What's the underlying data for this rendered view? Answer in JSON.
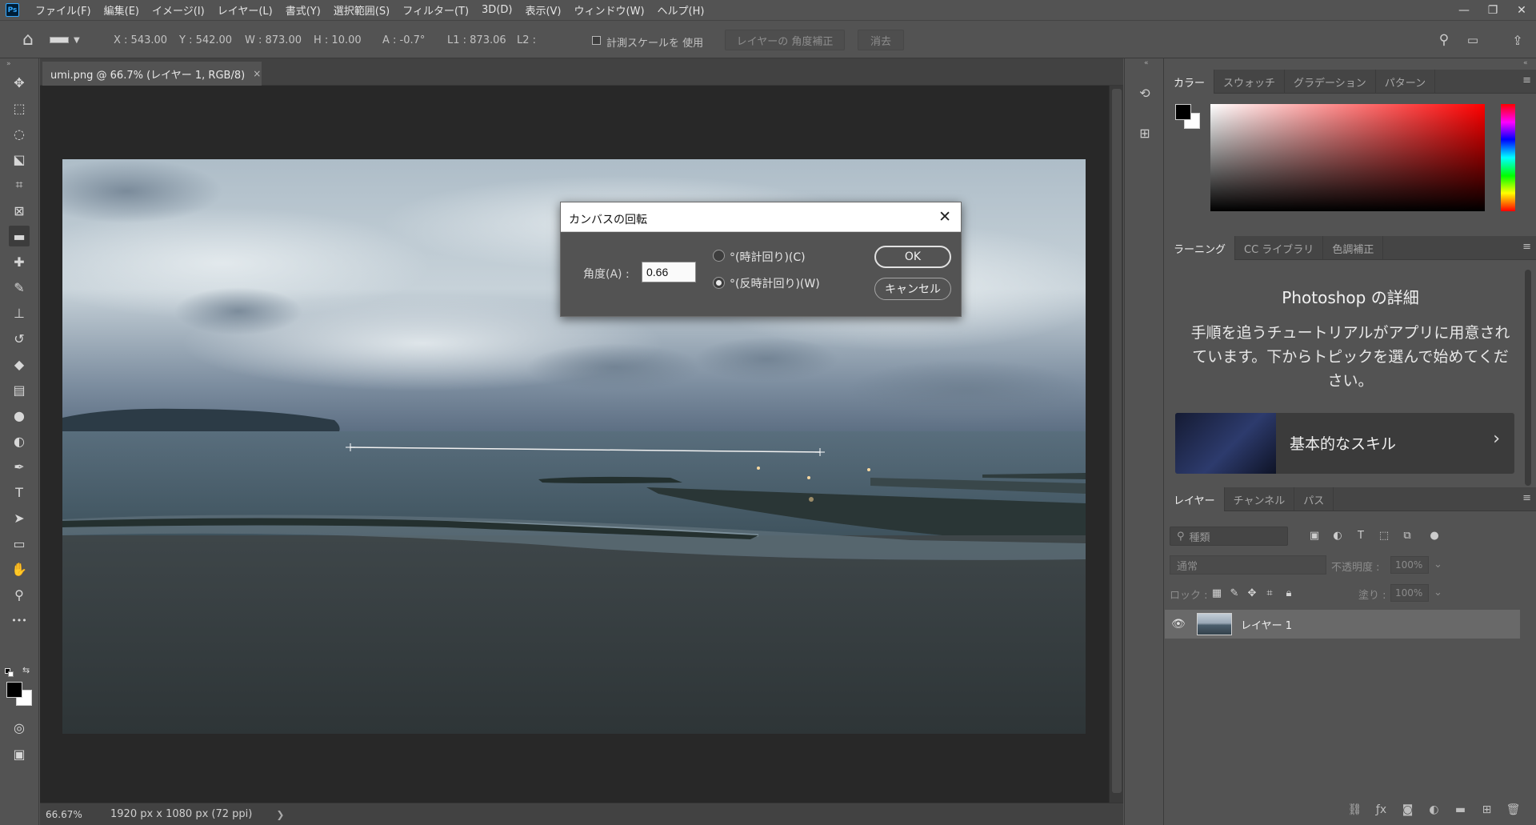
{
  "menubar": {
    "logo": "Ps",
    "items": [
      "ファイル(F)",
      "編集(E)",
      "イメージ(I)",
      "レイヤー(L)",
      "書式(Y)",
      "選択範囲(S)",
      "フィルター(T)",
      "3D(D)",
      "表示(V)",
      "ウィンドウ(W)",
      "ヘルプ(H)"
    ],
    "minimize": "—",
    "restore": "❐",
    "close": "✕"
  },
  "options": {
    "home_glyph": "⌂",
    "x": "X : 543.00",
    "y": "Y : 542.00",
    "w": "W : 873.00",
    "h": "H : 10.00",
    "a": "A : -0.7°",
    "l1": "L1 : 873.06",
    "l2": "L2 :",
    "use_scale": "計測スケールを 使用",
    "straighten": "レイヤーの 角度補正",
    "clear": "消去"
  },
  "document": {
    "tab_title": "umi.png @ 66.7% (レイヤー 1, RGB/8)",
    "tab_close": "×",
    "zoom": "66.67%",
    "info": "1920 px x 1080 px (72 ppi)",
    "status_arrow": "❯"
  },
  "toolbar": {
    "tools": [
      {
        "name": "move-tool-icon",
        "glyph": "✥"
      },
      {
        "name": "marquee-tool-icon",
        "glyph": "⬚"
      },
      {
        "name": "lasso-tool-icon",
        "glyph": "◌"
      },
      {
        "name": "object-select-tool-icon",
        "glyph": "⬕"
      },
      {
        "name": "crop-tool-icon",
        "glyph": "⌗"
      },
      {
        "name": "frame-tool-icon",
        "glyph": "⊠"
      },
      {
        "name": "ruler-tool-icon",
        "glyph": "▬"
      },
      {
        "name": "healing-brush-tool-icon",
        "glyph": "✚"
      },
      {
        "name": "brush-tool-icon",
        "glyph": "✎"
      },
      {
        "name": "stamp-tool-icon",
        "glyph": "⊥"
      },
      {
        "name": "history-brush-tool-icon",
        "glyph": "↺"
      },
      {
        "name": "eraser-tool-icon",
        "glyph": "◆"
      },
      {
        "name": "gradient-tool-icon",
        "glyph": "▤"
      },
      {
        "name": "blur-tool-icon",
        "glyph": "●"
      },
      {
        "name": "dodge-tool-icon",
        "glyph": "◐"
      },
      {
        "name": "pen-tool-icon",
        "glyph": "✒"
      },
      {
        "name": "type-tool-icon",
        "glyph": "T"
      },
      {
        "name": "path-select-tool-icon",
        "glyph": "➤"
      },
      {
        "name": "shape-tool-icon",
        "glyph": "▭"
      },
      {
        "name": "hand-tool-icon",
        "glyph": "✋"
      },
      {
        "name": "zoom-tool-icon",
        "glyph": "⚲"
      },
      {
        "name": "more-tools-icon",
        "glyph": "•••"
      }
    ],
    "quickmask_glyph": "◎",
    "screenmode_glyph": "▣"
  },
  "panels": {
    "color_tabs": [
      "カラー",
      "スウォッチ",
      "グラデーション",
      "パターン"
    ],
    "learn_tabs": [
      "ラーニング",
      "CC ライブラリ",
      "色調補正"
    ],
    "learn_title": "Photoshop の詳細",
    "learn_body": "手順を追うチュートリアルがアプリに用意されています。下からトピックを選んで始めてください。",
    "skill_label": "基本的なスキル",
    "skill_chevron": "›",
    "layer_tabs": [
      "レイヤー",
      "チャンネル",
      "パス"
    ],
    "search_placeholder": "種類",
    "blend_mode": "通常",
    "opacity_label": "不透明度 :",
    "opacity_value": "100%",
    "lock_label": "ロック :",
    "fill_label": "塗り :",
    "fill_value": "100%",
    "layer_name": "レイヤー 1",
    "menu_glyph": "≡",
    "collapse_glyph": "«"
  },
  "dialog": {
    "title": "カンバスの回転",
    "angle_label": "角度(A) :",
    "angle_value": "0.66",
    "cw_label": "°(時計回り)(C)",
    "ccw_label": "°(反時計回り)(W)",
    "ok": "OK",
    "cancel": "キャンセル",
    "close": "✕"
  },
  "colors": {
    "foreground": "#000000",
    "background": "#ffffff"
  }
}
